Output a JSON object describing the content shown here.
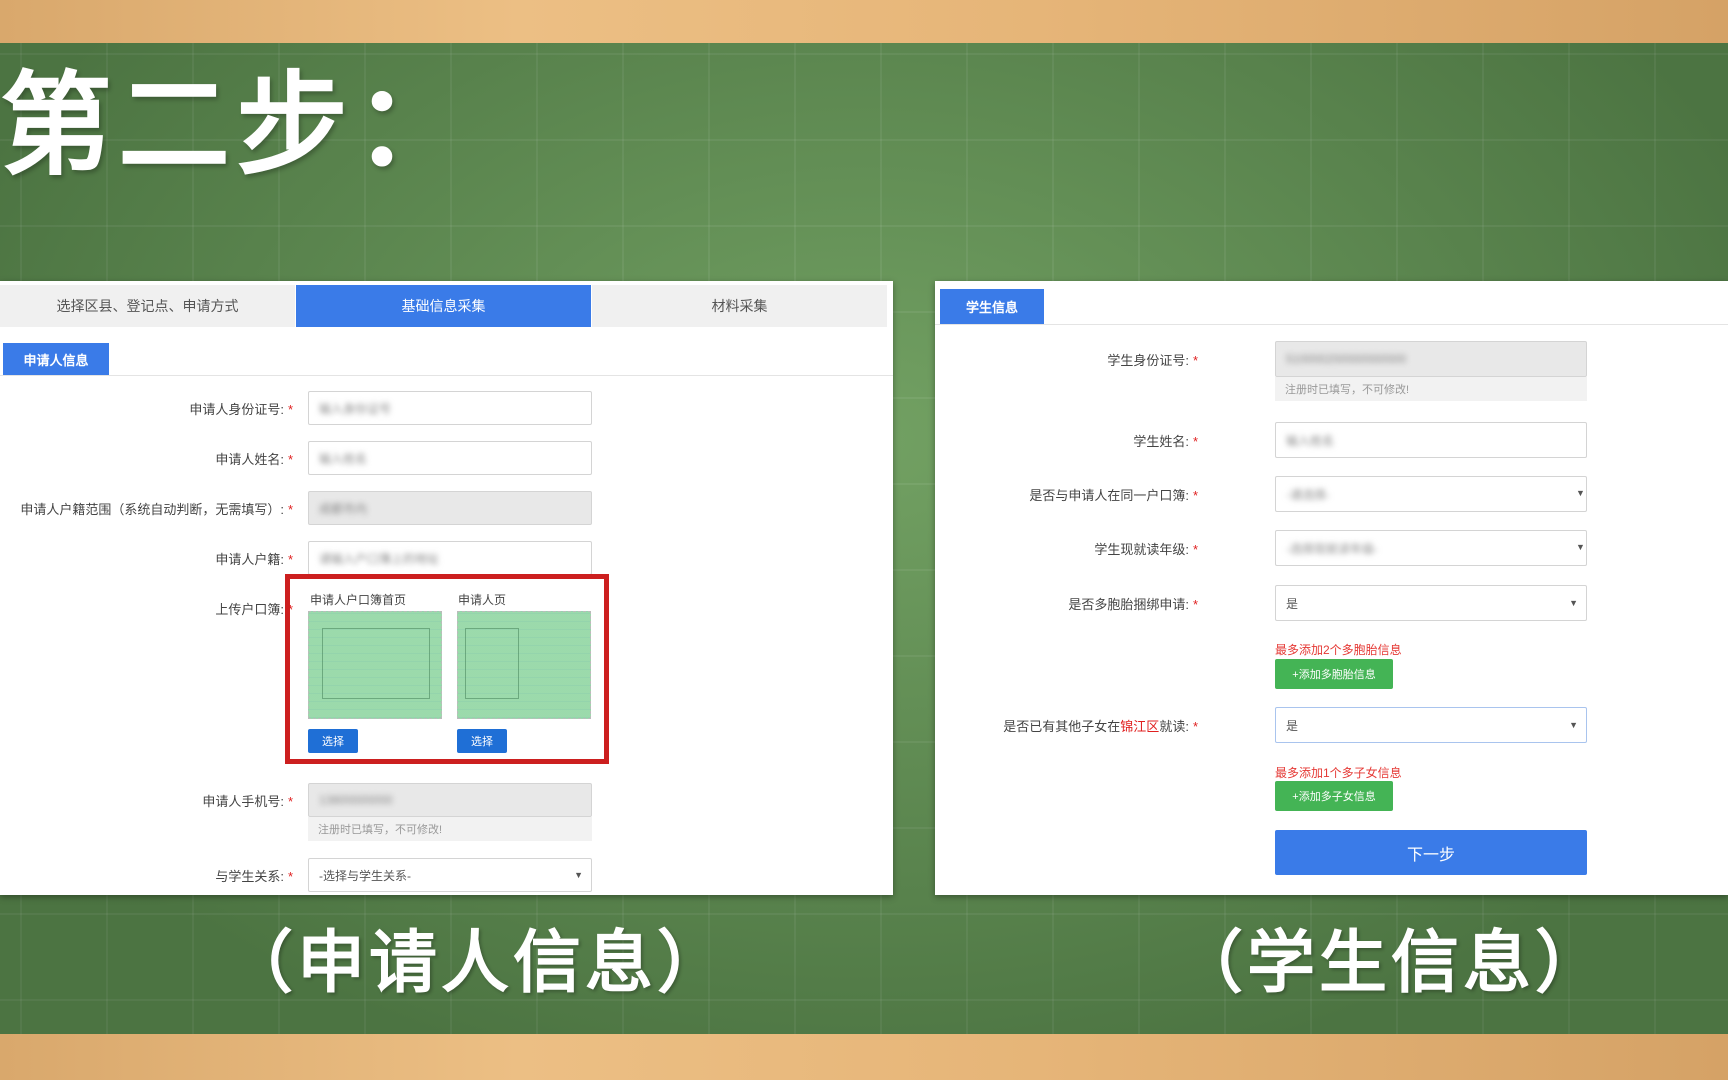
{
  "heading": "第二步：",
  "captions": {
    "left": "（申请人信息）",
    "right": "（学生信息）"
  },
  "applicant_panel": {
    "steps": [
      "选择区县、登记点、申请方式",
      "基础信息采集",
      "材料采集"
    ],
    "active_step": "基础信息采集",
    "section_title": "申请人信息",
    "fields": {
      "id_number": {
        "label": "申请人身份证号:",
        "value": "输入身份证号"
      },
      "name": {
        "label": "申请人姓名:",
        "value": "输入姓名"
      },
      "hukou_scope": {
        "label": "申请人户籍范围（系统自动判断，无需填写）:",
        "value": "成都市内"
      },
      "hukou": {
        "label": "申请人户籍:",
        "value": "请输入户口簿上的地址"
      },
      "upload": {
        "label": "上传户口簿:",
        "slot1_title": "申请人户口簿首页",
        "slot2_title": "申请人页",
        "select_label": "选择"
      },
      "phone": {
        "label": "申请人手机号:",
        "value": "13800000000",
        "hint": "注册时已填写，不可修改!"
      },
      "relation": {
        "label": "与学生关系:",
        "value": "-选择与学生关系-"
      }
    }
  },
  "student_panel": {
    "section_title": "学生信息",
    "fields": {
      "id_number": {
        "label": "学生身份证号:",
        "value": "510000200000000000",
        "hint": "注册时已填写，不可修改!"
      },
      "name": {
        "label": "学生姓名:",
        "value": "输入姓名"
      },
      "same_hukou": {
        "label": "是否与申请人在同一户口簿:",
        "value": "-请选择-"
      },
      "grade": {
        "label": "学生现就读年级:",
        "value": "-选择现就读年级-"
      },
      "multiple_birth": {
        "label": "是否多胞胎捆绑申请:",
        "value": "是",
        "note": "最多添加2个多胞胎信息",
        "add_button": "+添加多胞胎信息"
      },
      "sibling": {
        "label_prefix": "是否已有其他子女在",
        "label_district": "锦江区",
        "label_suffix": "就读:",
        "value": "是",
        "note": "最多添加1个多子女信息",
        "add_button": "+添加多子女信息"
      }
    },
    "next_button": "下一步"
  }
}
